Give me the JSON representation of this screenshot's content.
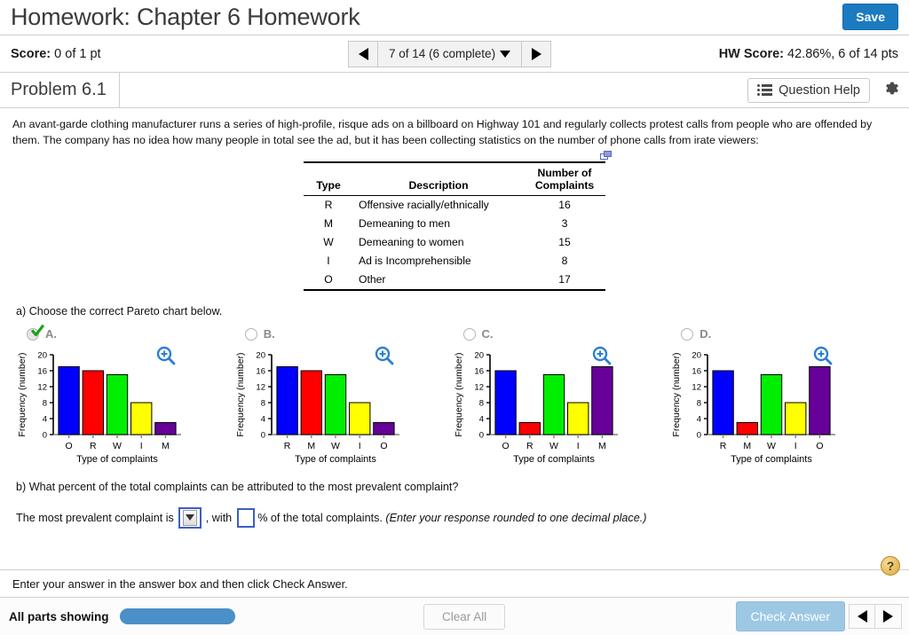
{
  "header": {
    "title": "Homework: Chapter 6 Homework",
    "save_label": "Save",
    "save_color": "#1c7ac0"
  },
  "scorebar": {
    "score_label": "Score:",
    "score_value": "0 of 1 pt",
    "nav_value": "7 of 14 (6 complete)",
    "prev_icon": "triangle-left-icon",
    "next_icon": "triangle-right-icon",
    "dropdown_icon": "triangle-down-icon",
    "hw_score_label": "HW Score:",
    "hw_score_value": "42.86%, 6 of 14 pts"
  },
  "problembar": {
    "problem_title": "Problem 6.1",
    "question_help_label": "Question Help",
    "list_icon": "list-icon",
    "gear_icon": "gear-icon"
  },
  "question": {
    "prompt": "An avant-garde clothing manufacturer runs a series of high-profile, risque ads on a billboard on Highway 101 and regularly collects protest calls from people who are offended by them. The company has no idea how many people in total see the ad, but it has been collecting statistics on the number of phone calls from irate viewers:",
    "popout_icon": "popout-window-icon"
  },
  "data_table": {
    "columns": [
      "Type",
      "Description",
      "Number of Complaints"
    ],
    "col_num_line1": "Number of",
    "col_num_line2": "Complaints",
    "rows": [
      {
        "type": "R",
        "description": "Offensive racially/ethnically",
        "count": "16"
      },
      {
        "type": "M",
        "description": "Demeaning to men",
        "count": "3"
      },
      {
        "type": "W",
        "description": "Demeaning to women",
        "count": "15"
      },
      {
        "type": "I",
        "description": "Ad is Incomprehensible",
        "count": "8"
      },
      {
        "type": "O",
        "description": "Other",
        "count": "17"
      }
    ]
  },
  "part_a": {
    "label": "a) Choose the correct Pareto chart below.",
    "magnifier_icon": "zoom-in-icon",
    "selected": "A",
    "options": [
      {
        "letter": "A.",
        "selected": true,
        "check_icon": "green-check-icon"
      },
      {
        "letter": "B.",
        "selected": false
      },
      {
        "letter": "C.",
        "selected": false
      },
      {
        "letter": "D.",
        "selected": false
      }
    ]
  },
  "chart_data": [
    {
      "type": "bar",
      "option": "A",
      "categories": [
        "O",
        "R",
        "W",
        "I",
        "M"
      ],
      "values": [
        17,
        16,
        15,
        8,
        3
      ],
      "colors": [
        "#0000ff",
        "#ff0000",
        "#00ee00",
        "#ffff00",
        "#660099"
      ],
      "title": "",
      "xlabel": "Type of complaints",
      "ylabel": "Frequency (number)",
      "ylim": [
        0,
        20
      ],
      "yticks": [
        0,
        4,
        8,
        12,
        16,
        20
      ],
      "grid": false,
      "legend": "none"
    },
    {
      "type": "bar",
      "option": "B",
      "categories": [
        "R",
        "M",
        "W",
        "I",
        "O"
      ],
      "values": [
        17,
        16,
        15,
        8,
        3
      ],
      "colors": [
        "#0000ff",
        "#ff0000",
        "#00ee00",
        "#ffff00",
        "#660099"
      ],
      "title": "",
      "xlabel": "Type of complaints",
      "ylabel": "Frequency (number)",
      "ylim": [
        0,
        20
      ],
      "yticks": [
        0,
        4,
        8,
        12,
        16,
        20
      ],
      "grid": false,
      "legend": "none"
    },
    {
      "type": "bar",
      "option": "C",
      "categories": [
        "O",
        "R",
        "W",
        "I",
        "M"
      ],
      "values": [
        16,
        3,
        15,
        8,
        17
      ],
      "colors": [
        "#0000ff",
        "#ff0000",
        "#00ee00",
        "#ffff00",
        "#660099"
      ],
      "title": "",
      "xlabel": "Type of complaints",
      "ylabel": "Frequency (number)",
      "ylim": [
        0,
        20
      ],
      "yticks": [
        0,
        4,
        8,
        12,
        16,
        20
      ],
      "grid": false,
      "legend": "none"
    },
    {
      "type": "bar",
      "option": "D",
      "categories": [
        "R",
        "M",
        "W",
        "I",
        "O"
      ],
      "values": [
        16,
        3,
        15,
        8,
        17
      ],
      "colors": [
        "#0000ff",
        "#ff0000",
        "#00ee00",
        "#ffff00",
        "#660099"
      ],
      "title": "",
      "xlabel": "Type of complaints",
      "ylabel": "Frequency (number)",
      "ylim": [
        0,
        20
      ],
      "yticks": [
        0,
        4,
        8,
        12,
        16,
        20
      ],
      "grid": false,
      "legend": "none"
    }
  ],
  "part_b": {
    "question": "b) What percent of the total complaints can be attributed to the most prevalent complaint?",
    "answer_prefix": "The most prevalent complaint is",
    "answer_middle": ", with",
    "answer_suffix": "% of the total complaints.",
    "answer_note": "(Enter your response rounded to one decimal place.)",
    "select_value": "",
    "percent_value": "",
    "dropdown_icon": "triangle-down-icon"
  },
  "footer": {
    "hint": "Enter your answer in the answer box and then click Check Answer.",
    "help_badge": "?",
    "parts_label": "All parts showing",
    "clear_all_label": "Clear All",
    "check_answer_label": "Check Answer",
    "prev_icon": "triangle-left-icon",
    "next_icon": "triangle-right-icon",
    "progress_color": "#4a8fc7"
  }
}
